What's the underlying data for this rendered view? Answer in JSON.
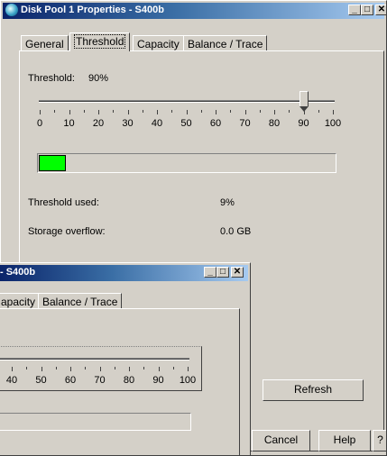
{
  "back_window": {
    "title": "Disk Pool 1 Properties - S400b",
    "tabs": [
      "General",
      "Threshold",
      "Capacity",
      "Balance / Trace"
    ],
    "threshold_label": "Threshold:",
    "threshold_value": "90%",
    "slider_ticks": [
      "0",
      "10",
      "20",
      "30",
      "40",
      "50",
      "60",
      "70",
      "80",
      "90",
      "100"
    ],
    "slider_value_percent": 90,
    "progress_fill_percent": 9,
    "threshold_used_label": "Threshold used:",
    "threshold_used_value": "9%",
    "storage_overflow_label": "Storage overflow:",
    "storage_overflow_value": "0.0 GB",
    "refresh_button": "Refresh",
    "cancel_button": "Cancel",
    "help_button": "Help",
    "question_button": "?"
  },
  "front_window": {
    "title": "- S400b",
    "tabs_partial": [
      "apacity",
      "Balance / Trace"
    ],
    "slider_ticks_visible": [
      "40",
      "50",
      "60",
      "70",
      "80",
      "90",
      "100"
    ]
  }
}
